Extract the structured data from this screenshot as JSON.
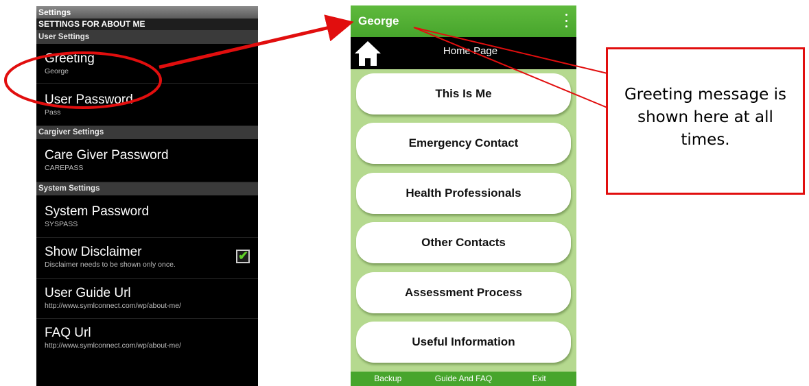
{
  "settings_screen": {
    "title_bar": "Settings",
    "subtitle": "SETTINGS FOR ABOUT ME",
    "sections": [
      {
        "header": "User Settings",
        "items": [
          {
            "title": "Greeting",
            "value": "George"
          },
          {
            "title": "User Password",
            "value": "Pass"
          }
        ]
      },
      {
        "header": "Cargiver Settings",
        "items": [
          {
            "title": "Care Giver Password",
            "value": "CAREPASS"
          }
        ]
      },
      {
        "header": "System Settings",
        "items": [
          {
            "title": "System  Password",
            "value": "SYSPASS"
          },
          {
            "title": "Show Disclaimer",
            "value": "Disclaimer needs to be shown only once.",
            "checked": true
          },
          {
            "title": "User Guide Url",
            "value": "http://www.symlconnect.com/wp/about-me/"
          },
          {
            "title": "FAQ Url",
            "value": "http://www.symlconnect.com/wp/about-me/"
          }
        ]
      }
    ]
  },
  "home_screen": {
    "app_bar_title": "George",
    "menu_icon": "overflow-menu-icon",
    "nav_title": "Home Page",
    "home_icon": "house-icon",
    "buttons": [
      "This Is Me",
      "Emergency Contact",
      "Health Professionals",
      "Other Contacts",
      "Assessment Process",
      "Useful Information"
    ],
    "bottom_bar": [
      "Backup",
      "Guide And FAQ",
      "Exit"
    ]
  },
  "callout": {
    "text": "Greeting message is shown here at all times."
  },
  "colors": {
    "annotation_red": "#e10e0e",
    "app_green": "#47a52c",
    "light_green": "#b5d98f",
    "check_green": "#5fcf28"
  }
}
